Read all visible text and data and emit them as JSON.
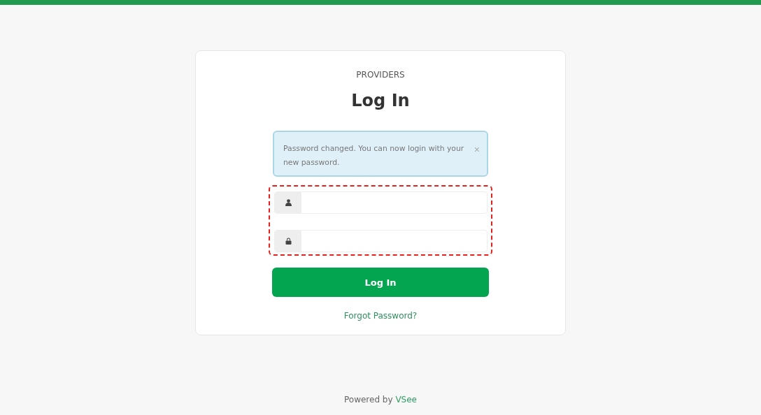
{
  "card": {
    "section": "PROVIDERS",
    "title": "Log In"
  },
  "alert": {
    "text": "Password changed. You can now login with your new password.",
    "close": "×"
  },
  "credentials": {
    "highlighted": true,
    "fields": [
      {
        "kind": "user"
      },
      {
        "kind": "lock"
      }
    ]
  },
  "submit": "Log In",
  "forgot_link": "Forgot Password?",
  "footer": {
    "prefix": "Powered by",
    "link": "VSee"
  }
}
